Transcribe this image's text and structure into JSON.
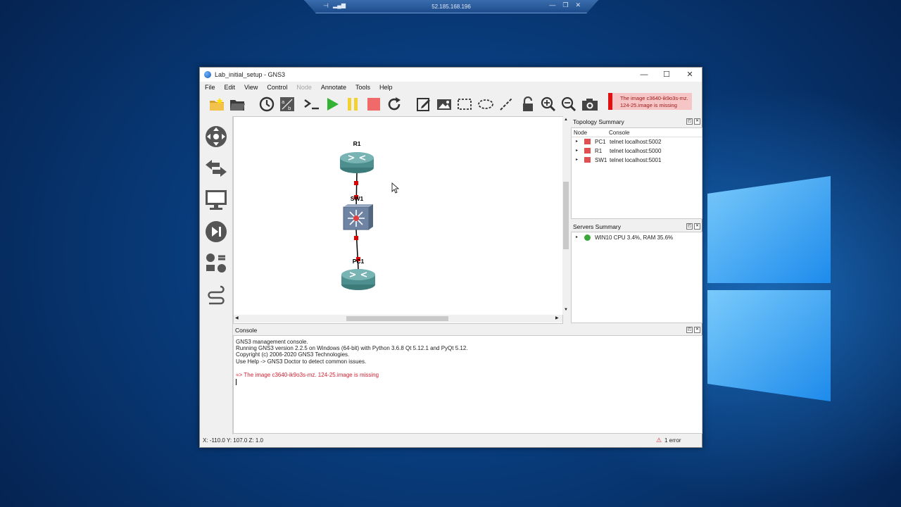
{
  "rdp": {
    "ip": "52.185.168.196"
  },
  "window": {
    "title": "Lab_initial_setup - GNS3",
    "minimize_glyph": "—",
    "maximize_glyph": "☐",
    "close_glyph": "✕"
  },
  "menu": [
    {
      "label": "File",
      "enabled": true
    },
    {
      "label": "Edit",
      "enabled": true
    },
    {
      "label": "View",
      "enabled": true
    },
    {
      "label": "Control",
      "enabled": true
    },
    {
      "label": "Node",
      "enabled": false
    },
    {
      "label": "Annotate",
      "enabled": true
    },
    {
      "label": "Tools",
      "enabled": true
    },
    {
      "label": "Help",
      "enabled": true
    }
  ],
  "toolbar_icons": [
    "new-project-icon",
    "open-project-icon",
    "snapshot-icon",
    "show-interfaces-icon",
    "console-all-icon",
    "start-all-icon",
    "suspend-all-icon",
    "stop-all-icon",
    "reload-all-icon",
    "add-note-icon",
    "insert-image-icon",
    "draw-rectangle-icon",
    "draw-ellipse-icon",
    "draw-line-icon",
    "lock-icon",
    "zoom-in-icon",
    "zoom-out-icon",
    "screenshot-icon"
  ],
  "notification": {
    "line1": "The image c3640-ik9o3s-mz.",
    "line2": "124-25.image is missing"
  },
  "canvas": {
    "nodes": [
      {
        "label": "R1",
        "type": "router"
      },
      {
        "label": "SW1",
        "type": "switch"
      },
      {
        "label": "PC1",
        "type": "router"
      }
    ]
  },
  "topology_summary": {
    "title": "Topology Summary",
    "columns": [
      "Node",
      "Console"
    ],
    "rows": [
      {
        "node": "PC1",
        "console": "telnet localhost:5002"
      },
      {
        "node": "R1",
        "console": "telnet localhost:5000"
      },
      {
        "node": "SW1",
        "console": "telnet localhost:5001"
      }
    ]
  },
  "servers_summary": {
    "title": "Servers Summary",
    "rows": [
      {
        "text": "WIN10 CPU 3.4%, RAM 35.6%"
      }
    ]
  },
  "console": {
    "title": "Console",
    "lines": [
      "GNS3 management console.",
      "Running GNS3 version 2.2.5 on Windows (64-bit) with Python 3.6.8 Qt 5.12.1 and PyQt 5.12.",
      "Copyright (c) 2006-2020 GNS3 Technologies.",
      "Use Help -> GNS3 Doctor to detect common issues."
    ],
    "error_prefix": "=>",
    "error_text": "The image c3640-ik9o3s-mz. 124-25.image is missing"
  },
  "status": {
    "coords": "X: -110.0 Y: 107.0 Z: 1.0",
    "errors": "1 error"
  },
  "colors": {
    "router": "#4d8f8f",
    "switch": "#7a8da8",
    "error": "#d01f2f",
    "link_dot": "#e00000",
    "server_ok": "#3aa83a",
    "node_icon": "#e05050"
  }
}
